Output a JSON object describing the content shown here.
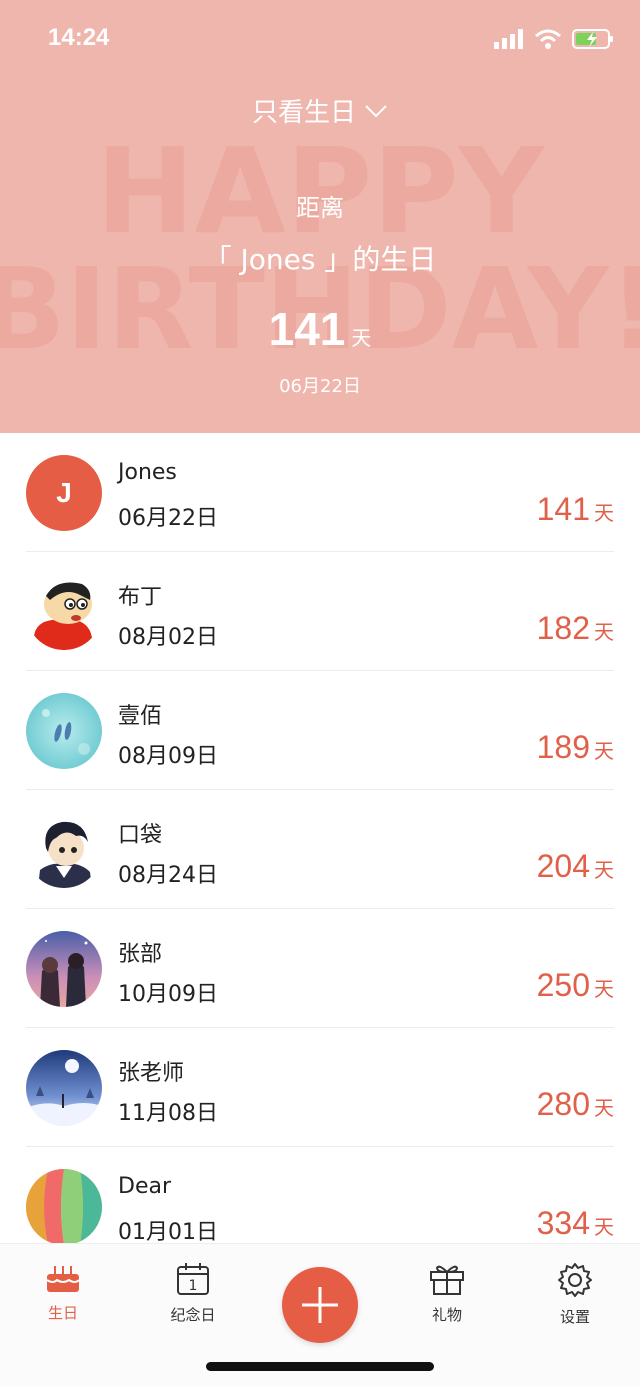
{
  "status": {
    "time": "14:24"
  },
  "header": {
    "filter_label": "只看生日",
    "distance_label": "距离",
    "target_prefix": "「 ",
    "target_name": "Jones",
    "target_suffix": " 」的生日",
    "days": "141",
    "days_unit": "天",
    "date": "06月22日",
    "bg_text_line1": "HAPPY",
    "bg_text_line2": "BIRTHDAY!"
  },
  "colors": {
    "header_bg": "#efb6ad",
    "accent": "#e0604a",
    "fab": "#e65d45"
  },
  "people": [
    {
      "name": "Jones",
      "date": "06月22日",
      "days": "141",
      "unit": "天",
      "avatar": "letter-j-avatar",
      "initial": "J"
    },
    {
      "name": "布丁",
      "date": "08月02日",
      "days": "182",
      "unit": "天",
      "avatar": "cartoon-boy-avatar"
    },
    {
      "name": "壹佰",
      "date": "08月09日",
      "days": "189",
      "unit": "天",
      "avatar": "sea-avatar"
    },
    {
      "name": "口袋",
      "date": "08月24日",
      "days": "204",
      "unit": "天",
      "avatar": "anime-boy-avatar"
    },
    {
      "name": "张部",
      "date": "10月09日",
      "days": "250",
      "unit": "天",
      "avatar": "anime-couple-avatar"
    },
    {
      "name": "张老师",
      "date": "11月08日",
      "days": "280",
      "unit": "天",
      "avatar": "night-snow-avatar"
    },
    {
      "name": "Dear",
      "date": "01月01日",
      "days": "334",
      "unit": "天",
      "avatar": "balloon-avatar"
    }
  ],
  "tabs": [
    {
      "label": "生日",
      "icon": "cake-icon",
      "active": true
    },
    {
      "label": "纪念日",
      "icon": "calendar-icon",
      "active": false,
      "calendar_day": "1"
    },
    {
      "label": "礼物",
      "icon": "gift-icon",
      "active": false
    },
    {
      "label": "设置",
      "icon": "gear-icon",
      "active": false
    }
  ]
}
